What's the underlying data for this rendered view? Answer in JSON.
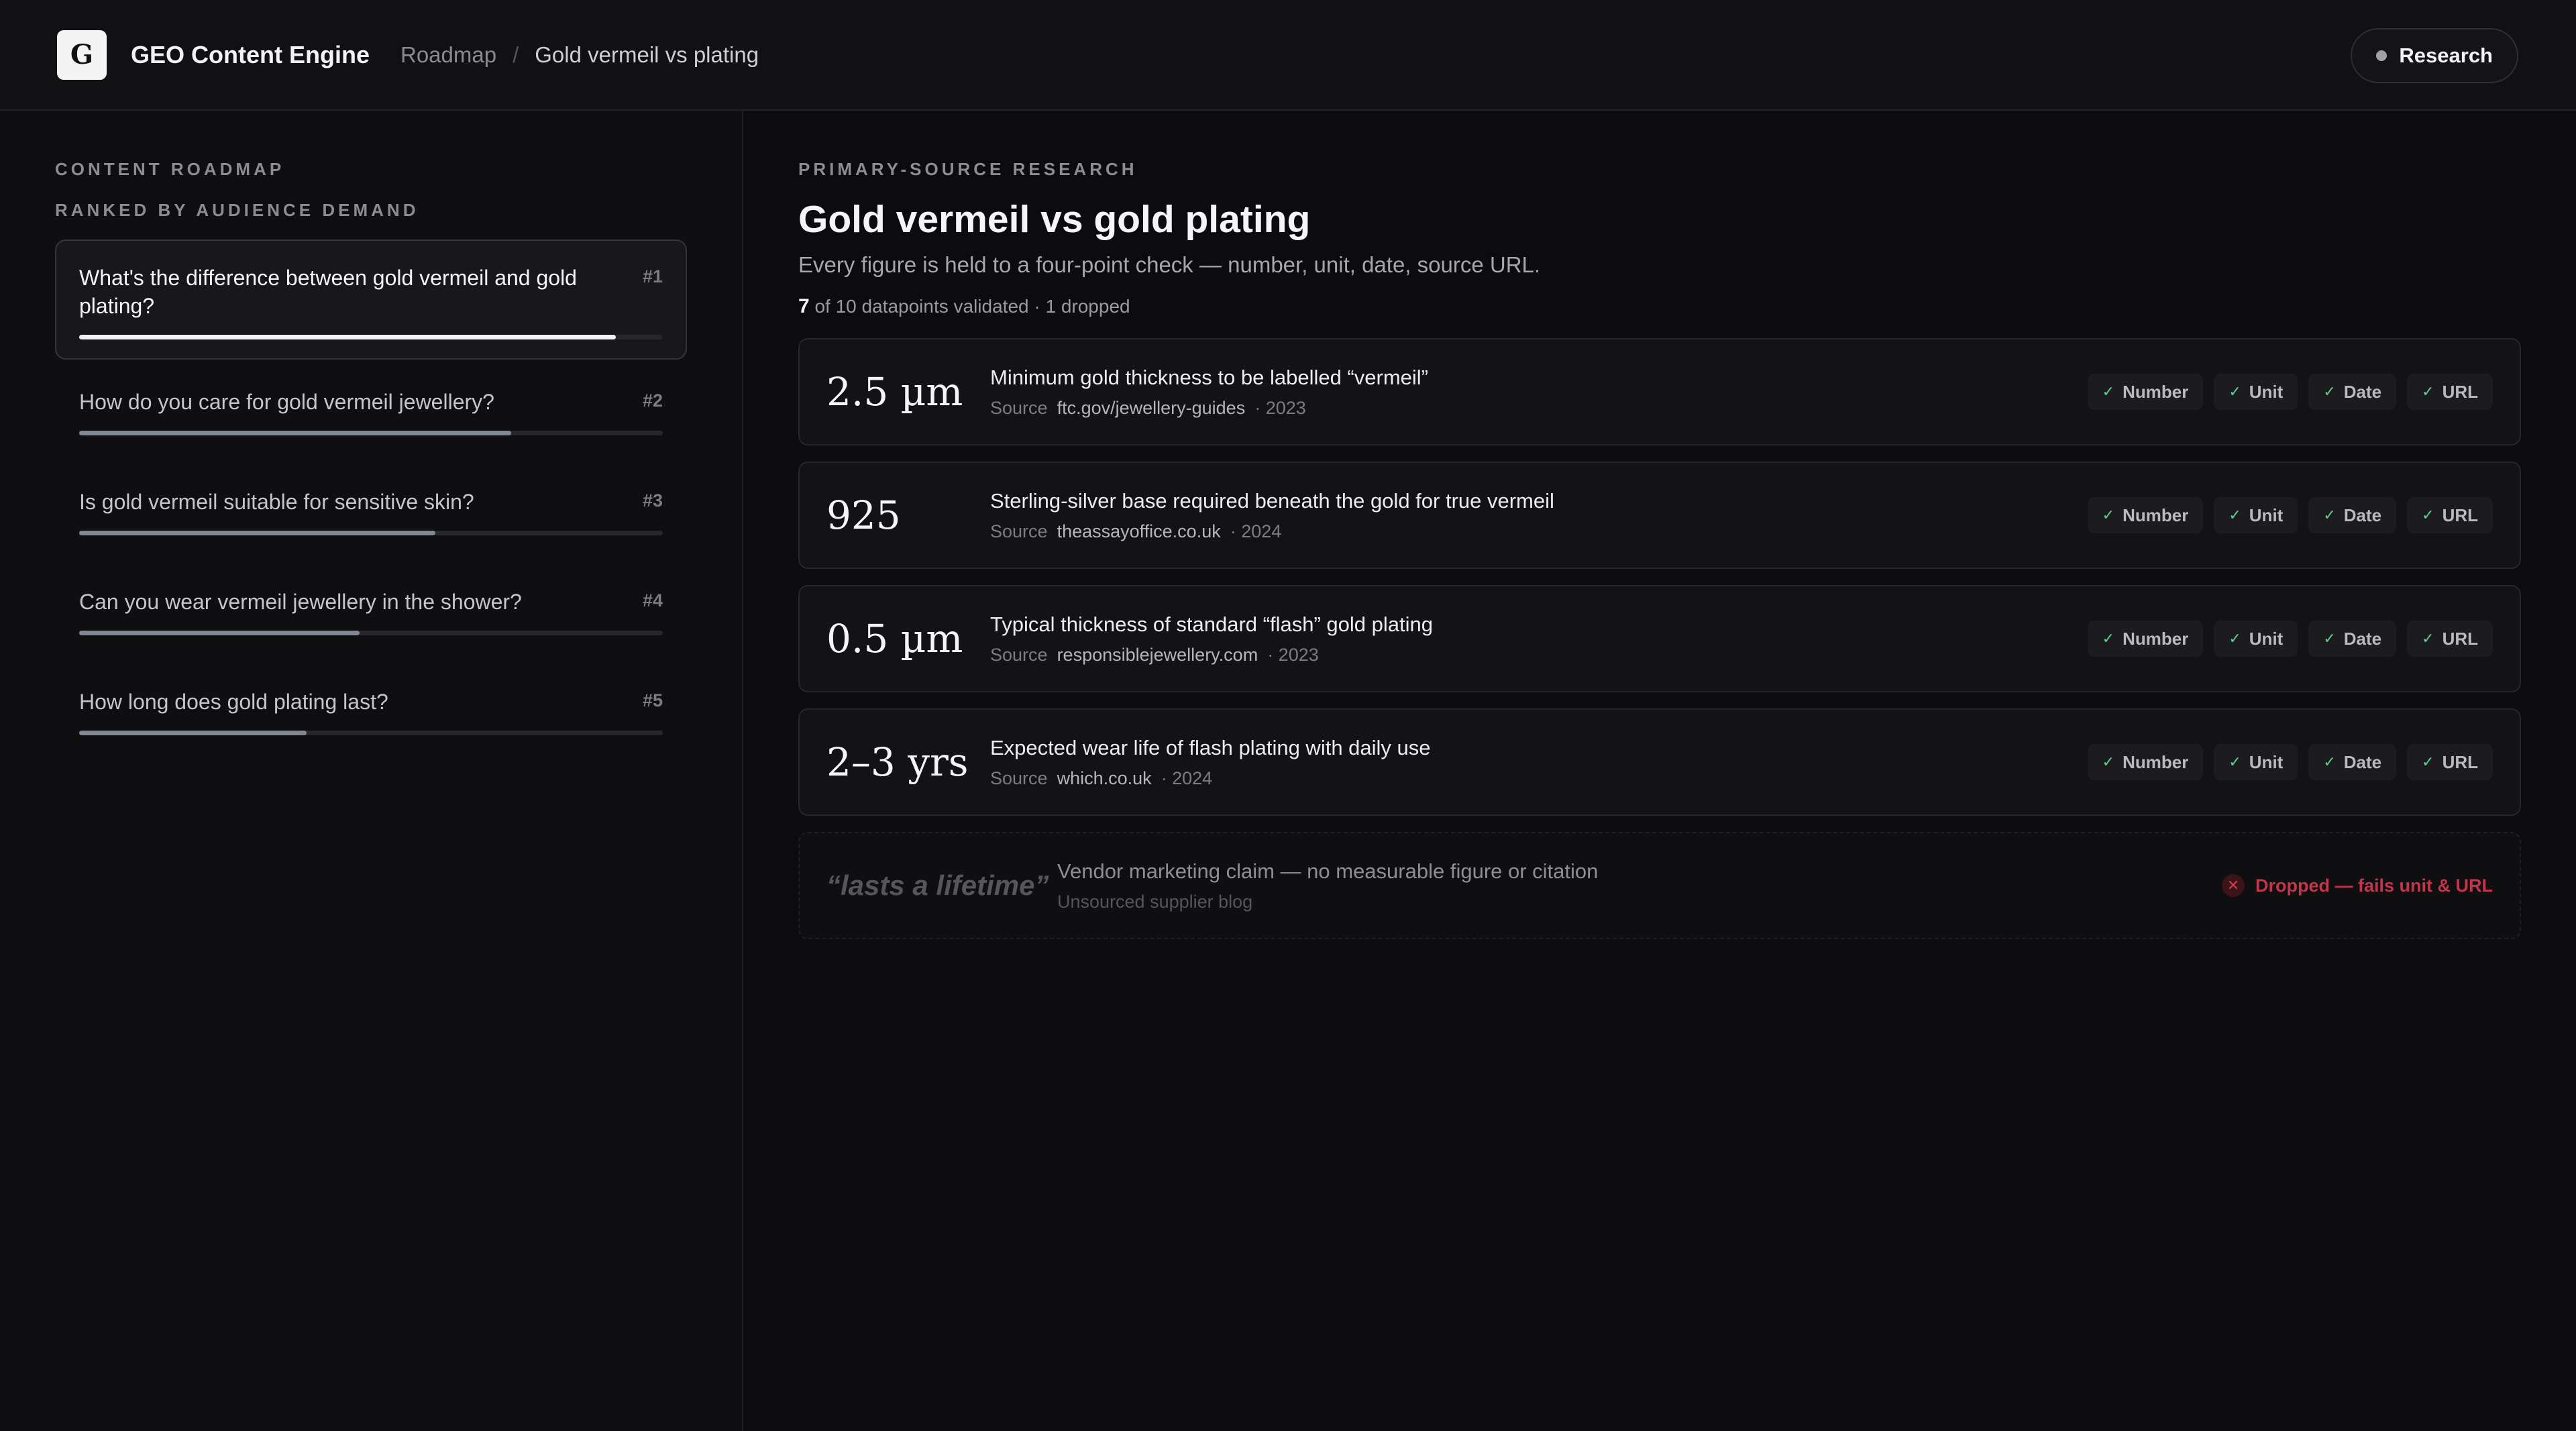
{
  "header": {
    "logo_letter": "G",
    "app_title": "GEO Content Engine",
    "breadcrumb": {
      "parent": "Roadmap",
      "separator": "/",
      "current": "Gold vermeil vs plating"
    },
    "research_button": "Research"
  },
  "sidebar": {
    "heading": "CONTENT ROADMAP",
    "subheading": "RANKED BY AUDIENCE DEMAND",
    "items": [
      {
        "question": "What's the difference between gold vermeil and gold plating?",
        "rank": "#1",
        "demand": 0.92,
        "active": true
      },
      {
        "question": "How do you care for gold vermeil jewellery?",
        "rank": "#2",
        "demand": 0.74,
        "active": false
      },
      {
        "question": "Is gold vermeil suitable for sensitive skin?",
        "rank": "#3",
        "demand": 0.61,
        "active": false
      },
      {
        "question": "Can you wear vermeil jewellery in the shower?",
        "rank": "#4",
        "demand": 0.48,
        "active": false
      },
      {
        "question": "How long does gold plating last?",
        "rank": "#5",
        "demand": 0.39,
        "active": false
      }
    ]
  },
  "main": {
    "eyebrow": "PRIMARY-SOURCE RESEARCH",
    "title": "Gold vermeil vs gold plating",
    "lede": "Every figure is held to a four-point check — number, unit, date, source URL.",
    "count": {
      "validated": "7",
      "rest": "of 10 datapoints validated · 1 dropped"
    },
    "source_label": "Source",
    "check_labels": [
      "Number",
      "Unit",
      "Date",
      "URL"
    ],
    "datapoints": [
      {
        "figure": "2.5 µm",
        "claim": "Minimum gold thickness to be labelled “vermeil”",
        "domain": "ftc.gov/jewellery-guides",
        "year": "· 2023"
      },
      {
        "figure": "925",
        "claim": "Sterling-silver base required beneath the gold for true vermeil",
        "domain": "theassayoffice.co.uk",
        "year": "· 2024"
      },
      {
        "figure": "0.5 µm",
        "claim": "Typical thickness of standard “flash” gold plating",
        "domain": "responsiblejewellery.com",
        "year": "· 2023"
      },
      {
        "figure": "2–3 yrs",
        "claim": "Expected wear life of flash plating with daily use",
        "domain": "which.co.uk",
        "year": "· 2024"
      }
    ],
    "dropped": {
      "figure": "“lasts a lifetime”",
      "claim": "Vendor marketing claim — no measurable figure or citation",
      "source": "Unsourced supplier blog",
      "badge": "Dropped — fails unit & URL"
    }
  }
}
